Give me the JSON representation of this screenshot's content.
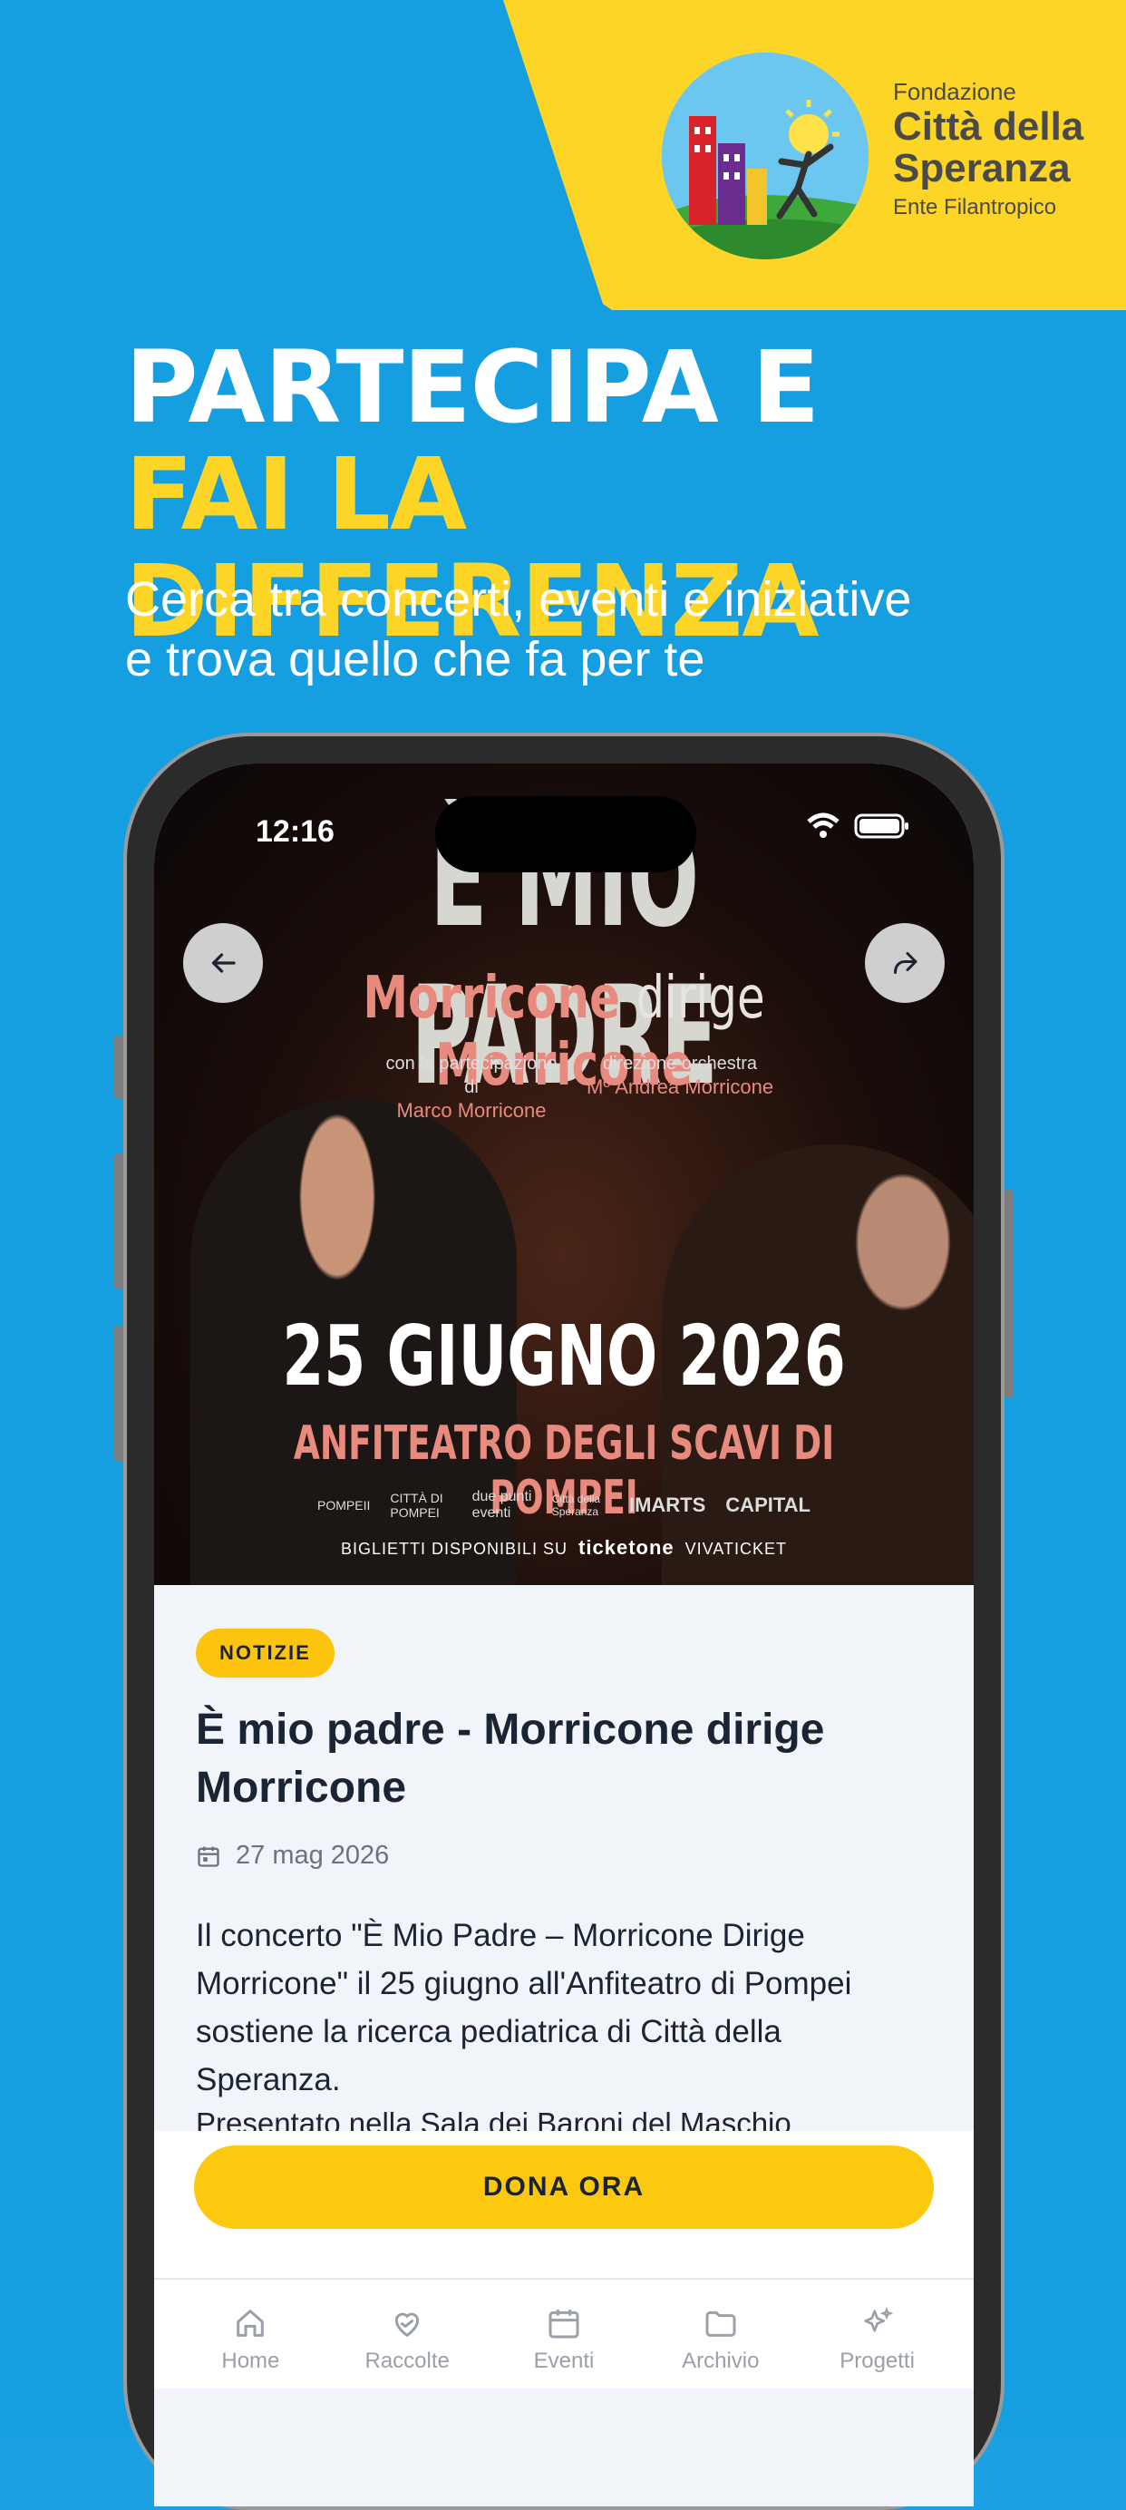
{
  "logo": {
    "line1": "Fondazione",
    "line2": "Città della",
    "line3": "Speranza",
    "line4": "Ente Filantropico"
  },
  "headline": {
    "line1": "PARTECIPA E",
    "line2": "FAI LA DIFFERENZA"
  },
  "subtitle": {
    "line1": "Cerca tra concerti, eventi e iniziative",
    "line2": "e trova quello che fa per te"
  },
  "status_bar": {
    "time": "12:16"
  },
  "poster": {
    "title": "È MIO PADRE",
    "subtitle_a": "Morricone",
    "subtitle_mid": "dirige",
    "subtitle_b": "Morricone",
    "credit_left_label": "con la partecipazione di",
    "credit_left_name": "Marco Morricone",
    "credit_right_label": "direzione orchestra",
    "credit_right_name": "Mº Andrea Morricone",
    "date": "25 GIUGNO 2026",
    "venue": "ANFITEATRO DEGLI SCAVI DI POMPEI",
    "sponsors": [
      "POMPEII",
      "CITTÀ DI POMPEI",
      "due punti eventi",
      "Città della Speranza",
      "IMARTS",
      "CAPITAL"
    ],
    "tickets_label": "BIGLIETTI DISPONIBILI SU",
    "ticket_vendor1": "ticketone",
    "ticket_vendor2": "VIVATICKET"
  },
  "article": {
    "badge": "NOTIZIE",
    "title": "È mio padre - Morricone dirige Morricone",
    "date": "27 mag 2026",
    "paragraph1": "Il concerto \"È Mio Padre – Morricone Dirige Morricone\" il 25 giugno all'Anfiteatro di Pompei sostiene la ricerca pediatrica di Città della Speranza.",
    "paragraph2": "Presentato nella Sala dei Baroni del Maschio"
  },
  "cta": {
    "label": "DONA ORA"
  },
  "tabs": [
    {
      "label": "Home",
      "icon": "home-icon"
    },
    {
      "label": "Raccolte",
      "icon": "heart-hand-icon"
    },
    {
      "label": "Eventi",
      "icon": "calendar-icon"
    },
    {
      "label": "Archivio",
      "icon": "folder-icon"
    },
    {
      "label": "Progetti",
      "icon": "sparkles-icon"
    }
  ],
  "colors": {
    "background": "#169fe0",
    "accent_yellow": "#fdd526",
    "button_yellow": "#fdc90e",
    "text_dark": "#1b2434",
    "poster_salmon": "#e88a7e"
  }
}
